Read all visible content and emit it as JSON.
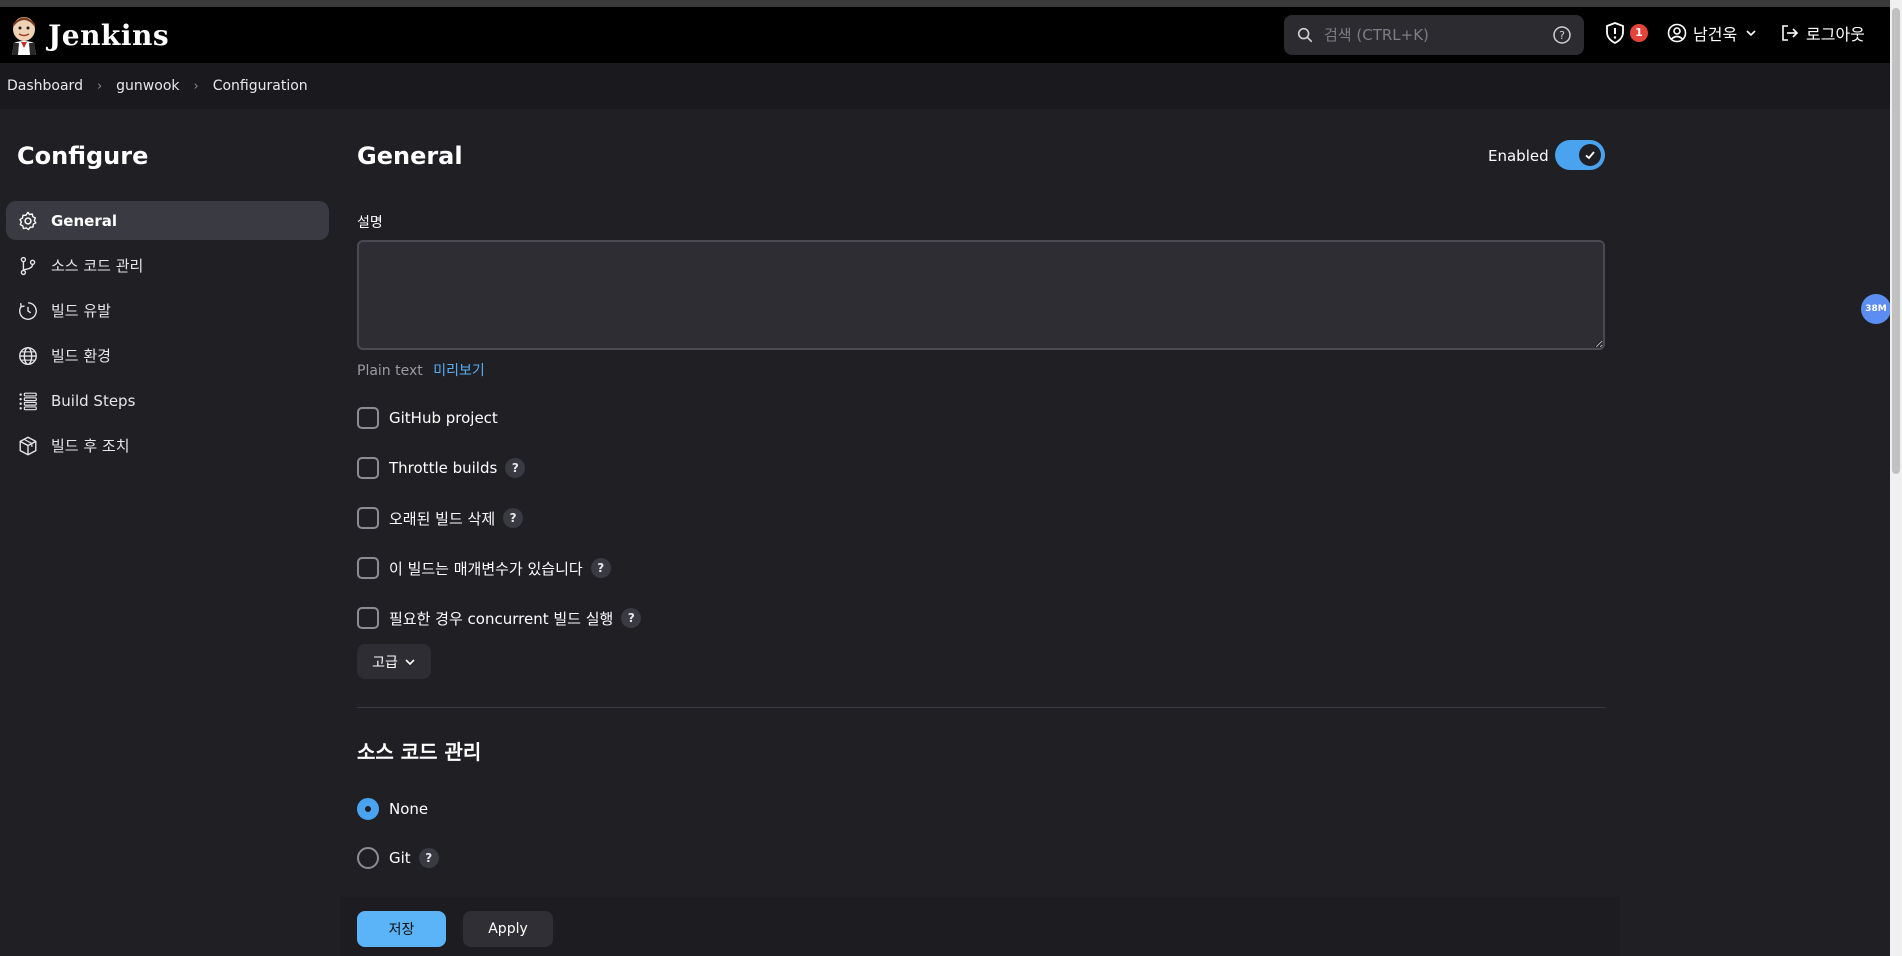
{
  "header": {
    "app_name": "Jenkins",
    "search_placeholder": "검색 (CTRL+K)",
    "security_count": "1",
    "user_name": "남건욱",
    "logout_label": "로그아웃"
  },
  "breadcrumb": {
    "items": [
      "Dashboard",
      "gunwook",
      "Configuration"
    ]
  },
  "sidebar": {
    "title": "Configure",
    "items": [
      {
        "label": "General",
        "icon": "gear-icon",
        "active": true
      },
      {
        "label": "소스 코드 관리",
        "icon": "branch-icon"
      },
      {
        "label": "빌드 유발",
        "icon": "clock-icon"
      },
      {
        "label": "빌드 환경",
        "icon": "globe-icon"
      },
      {
        "label": "Build Steps",
        "icon": "list-icon"
      },
      {
        "label": "빌드 후 조치",
        "icon": "cube-icon"
      }
    ]
  },
  "general": {
    "title": "General",
    "enabled_label": "Enabled",
    "enabled": true,
    "description_label": "설명",
    "description_value": "",
    "plain_text_label": "Plain text",
    "preview_label": "미리보기",
    "options": [
      {
        "label": "GitHub project",
        "help": false,
        "checked": false
      },
      {
        "label": "Throttle builds",
        "help": true,
        "checked": false
      },
      {
        "label": "오래된 빌드 삭제",
        "help": true,
        "checked": false
      },
      {
        "label": "이 빌드는 매개변수가 있습니다",
        "help": true,
        "checked": false
      },
      {
        "label": "필요한 경우 concurrent 빌드 실행",
        "help": true,
        "checked": false
      }
    ],
    "advanced_label": "고급",
    "help_glyph": "?"
  },
  "scm": {
    "title": "소스 코드 관리",
    "options": [
      {
        "label": "None",
        "selected": true,
        "help": false
      },
      {
        "label": "Git",
        "selected": false,
        "help": true
      }
    ]
  },
  "actions": {
    "save_label": "저장",
    "apply_label": "Apply"
  },
  "floating_badge": "38M",
  "colors": {
    "accent": "#4aa3ef",
    "background": "#1f1f24",
    "header": "#000000",
    "badge": "#e5443a"
  }
}
